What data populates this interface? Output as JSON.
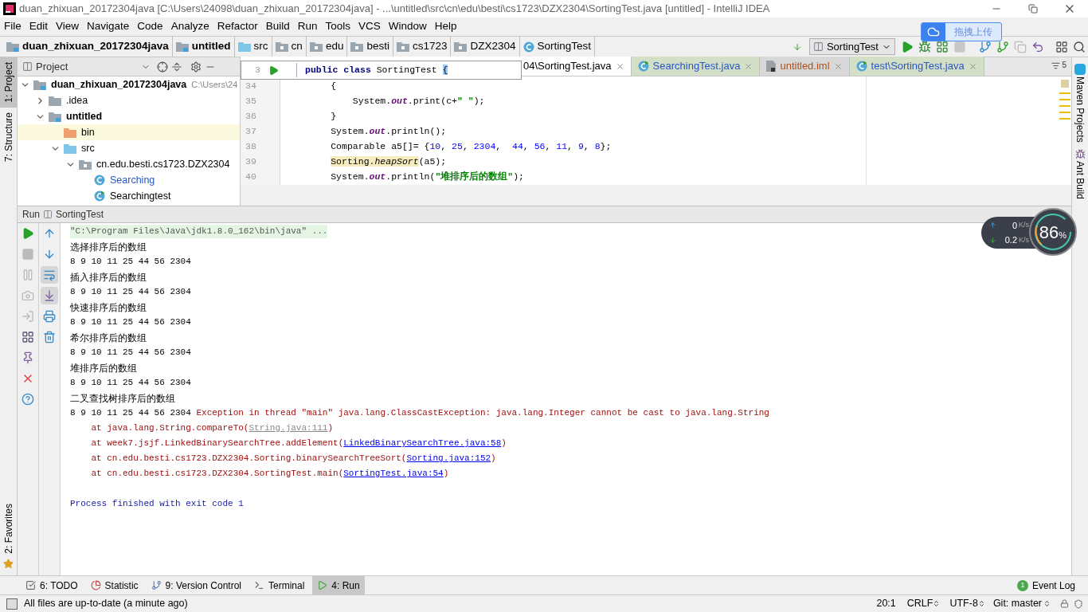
{
  "window": {
    "title": "duan_zhixuan_20172304java [C:\\Users\\24098\\duan_zhixuan_20172304java] - ...\\untitled\\src\\cn\\edu\\besti\\cs1723\\DZX2304\\SortingTest.java [untitled] - IntelliJ IDEA"
  },
  "menu": [
    "File",
    "Edit",
    "View",
    "Navigate",
    "Code",
    "Analyze",
    "Refactor",
    "Build",
    "Run",
    "Tools",
    "VCS",
    "Window",
    "Help"
  ],
  "breadcrumbs": [
    {
      "label": "duan_zhixuan_20172304java",
      "kind": "module"
    },
    {
      "label": "untitled",
      "kind": "module"
    },
    {
      "label": "src",
      "kind": "source"
    },
    {
      "label": "cn",
      "kind": "package"
    },
    {
      "label": "edu",
      "kind": "package"
    },
    {
      "label": "besti",
      "kind": "package"
    },
    {
      "label": "cs1723",
      "kind": "package"
    },
    {
      "label": "DZX2304",
      "kind": "package"
    },
    {
      "label": "SortingTest",
      "kind": "class"
    }
  ],
  "run_config": "SortingTest",
  "upload_badge": "拖拽上传",
  "left_strip": [
    {
      "label": "1: Project",
      "selected": true
    },
    {
      "label": "7: Structure",
      "selected": false
    },
    {
      "label": "2: Favorites",
      "selected": false
    }
  ],
  "right_strip": [
    "Maven Projects",
    "Ant Build"
  ],
  "project_panel": {
    "title": "Project",
    "tree": [
      {
        "label": "duan_zhixuan_20172304java",
        "hint": "C:\\Users\\24",
        "kind": "module",
        "expanded": true,
        "selected": false,
        "children": [
          {
            "label": ".idea",
            "kind": "folder",
            "expanded": false,
            "selected": false
          },
          {
            "label": "untitled",
            "kind": "module",
            "expanded": true,
            "selected": false,
            "children": [
              {
                "label": "bin",
                "kind": "excluded",
                "selected": true
              },
              {
                "label": "src",
                "kind": "source",
                "expanded": true,
                "selected": false,
                "children": [
                  {
                    "label": "cn.edu.besti.cs1723.DZX2304",
                    "kind": "package",
                    "expanded": true,
                    "selected": false,
                    "children": [
                      {
                        "label": "Searching",
                        "kind": "class",
                        "selected": false,
                        "color": "#2a56c6"
                      },
                      {
                        "label": "Searchingtest",
                        "kind": "test",
                        "selected": false,
                        "color": "#000000"
                      }
                    ]
                  }
                ]
              }
            ]
          }
        ]
      }
    ]
  },
  "editor": {
    "tabs": [
      {
        "label": "04\\SortingTest.java",
        "selected": true,
        "color": "#000000"
      },
      {
        "label": "SearchingTest.java",
        "kind": "test",
        "selected": false,
        "color": "#2a56c6"
      },
      {
        "label": "untitled.iml",
        "kind": "file",
        "selected": false,
        "color": "#b0501e"
      },
      {
        "label": "test\\SortingTest.java",
        "kind": "test",
        "selected": false,
        "color": "#2a56c6"
      }
    ],
    "tab_count": "5",
    "sticky_line": {
      "number": "3",
      "tokens": [
        {
          "text": "public class ",
          "kind": "keyword"
        },
        {
          "text": "SortingTest ",
          "kind": "plain"
        },
        {
          "text": "{",
          "kind": "brace"
        }
      ]
    },
    "lines": [
      {
        "number": "34",
        "tokens": [
          {
            "text": "        {",
            "kind": "plain"
          }
        ]
      },
      {
        "number": "35",
        "tokens": [
          {
            "text": "            System.",
            "kind": "plain"
          },
          {
            "text": "out",
            "kind": "field"
          },
          {
            "text": ".print(c+",
            "kind": "plain"
          },
          {
            "text": "\" \"",
            "kind": "string"
          },
          {
            "text": ");",
            "kind": "plain"
          }
        ]
      },
      {
        "number": "36",
        "tokens": [
          {
            "text": "        }",
            "kind": "plain"
          }
        ]
      },
      {
        "number": "37",
        "tokens": [
          {
            "text": "        System.",
            "kind": "plain"
          },
          {
            "text": "out",
            "kind": "field"
          },
          {
            "text": ".println();",
            "kind": "plain"
          }
        ]
      },
      {
        "number": "38",
        "tokens": [
          {
            "text": "        Comparable a5[]= {",
            "kind": "plain"
          },
          {
            "text": "10",
            "kind": "number"
          },
          {
            "text": ", ",
            "kind": "plain"
          },
          {
            "text": "25",
            "kind": "number"
          },
          {
            "text": ", ",
            "kind": "plain"
          },
          {
            "text": "2304",
            "kind": "number"
          },
          {
            "text": ",  ",
            "kind": "plain"
          },
          {
            "text": "44",
            "kind": "number"
          },
          {
            "text": ", ",
            "kind": "plain"
          },
          {
            "text": "56",
            "kind": "number"
          },
          {
            "text": ", ",
            "kind": "plain"
          },
          {
            "text": "11",
            "kind": "number"
          },
          {
            "text": ", ",
            "kind": "plain"
          },
          {
            "text": "9",
            "kind": "number"
          },
          {
            "text": ", ",
            "kind": "plain"
          },
          {
            "text": "8",
            "kind": "number"
          },
          {
            "text": "};",
            "kind": "plain"
          }
        ]
      },
      {
        "number": "39",
        "tokens": [
          {
            "text": "        Sorting.",
            "kind": "highlight"
          },
          {
            "text": "heapSort",
            "kind": "highlight-static"
          },
          {
            "text": "(a5);",
            "kind": "plain"
          }
        ]
      },
      {
        "number": "40",
        "tokens": [
          {
            "text": "        System.",
            "kind": "plain"
          },
          {
            "text": "out",
            "kind": "field"
          },
          {
            "text": ".println(",
            "kind": "plain"
          },
          {
            "text": "\"堆排序后的数组\"",
            "kind": "string"
          },
          {
            "text": ");",
            "kind": "plain"
          }
        ]
      }
    ]
  },
  "run_panel": {
    "label": "Run",
    "config": "SortingTest",
    "console": [
      [
        {
          "text": "\"C:\\Program Files\\Java\\jdk1.8.0_162\\bin\\java\" ...",
          "kind": "command"
        }
      ],
      [
        {
          "text": "选择排序后的数组",
          "kind": "cjk"
        }
      ],
      [
        {
          "text": "8 9 10 11 25 44 56 2304",
          "kind": "out"
        }
      ],
      [
        {
          "text": "插入排序后的数组",
          "kind": "cjk"
        }
      ],
      [
        {
          "text": "8 9 10 11 25 44 56 2304",
          "kind": "out"
        }
      ],
      [
        {
          "text": "快速排序后的数组",
          "kind": "cjk"
        }
      ],
      [
        {
          "text": "8 9 10 11 25 44 56 2304",
          "kind": "out"
        }
      ],
      [
        {
          "text": "希尔排序后的数组",
          "kind": "cjk"
        }
      ],
      [
        {
          "text": "8 9 10 11 25 44 56 2304",
          "kind": "out"
        }
      ],
      [
        {
          "text": "堆排序后的数组",
          "kind": "cjk"
        }
      ],
      [
        {
          "text": "8 9 10 11 25 44 56 2304",
          "kind": "out"
        }
      ],
      [
        {
          "text": "二叉查找树排序后的数组",
          "kind": "cjk"
        }
      ],
      [
        {
          "text": "8 9 10 11 25 44 56 2304 ",
          "kind": "out"
        },
        {
          "text": "Exception in thread \"main\" java.lang.ClassCastException: java.lang.Integer cannot be cast to java.lang.String",
          "kind": "err"
        }
      ],
      [
        {
          "text": "    at java.lang.String.compareTo(",
          "kind": "err"
        },
        {
          "text": "String.java:111",
          "kind": "lib-link"
        },
        {
          "text": ")",
          "kind": "err"
        }
      ],
      [
        {
          "text": "    at week7.jsjf.LinkedBinarySearchTree.addElement(",
          "kind": "err"
        },
        {
          "text": "LinkedBinarySearchTree.java:58",
          "kind": "link"
        },
        {
          "text": ")",
          "kind": "err"
        }
      ],
      [
        {
          "text": "    at cn.edu.besti.cs1723.DZX2304.Sorting.binarySearchTreeSort(",
          "kind": "err"
        },
        {
          "text": "Sorting.java:152",
          "kind": "link"
        },
        {
          "text": ")",
          "kind": "err"
        }
      ],
      [
        {
          "text": "    at cn.edu.besti.cs1723.DZX2304.SortingTest.main(",
          "kind": "err"
        },
        {
          "text": "SortingTest.java:54",
          "kind": "link"
        },
        {
          "text": ")",
          "kind": "err"
        }
      ],
      [
        {
          "text": "Process finished with exit code 1",
          "kind": "info"
        }
      ]
    ]
  },
  "net_widget": {
    "upload": "0",
    "upload_unit": "K/s",
    "download": "0.2",
    "download_unit": "K/s",
    "percent": "86",
    "percent_sign": "%"
  },
  "tool_windows": [
    {
      "label": "6: TODO",
      "kind": "todo",
      "selected": false
    },
    {
      "label": "Statistic",
      "kind": "statistic",
      "selected": false
    },
    {
      "label": "9: Version Control",
      "kind": "vcs",
      "selected": false
    },
    {
      "label": "Terminal",
      "kind": "terminal",
      "selected": false
    },
    {
      "label": "4: Run",
      "kind": "run",
      "selected": true
    }
  ],
  "event_log": {
    "label": "Event Log",
    "count": "1"
  },
  "status_bar": {
    "message": "All files are up-to-date (a minute ago)",
    "position": "20:1",
    "line_separator": "CRLF",
    "encoding": "UTF-8",
    "vcs": "Git: master"
  }
}
